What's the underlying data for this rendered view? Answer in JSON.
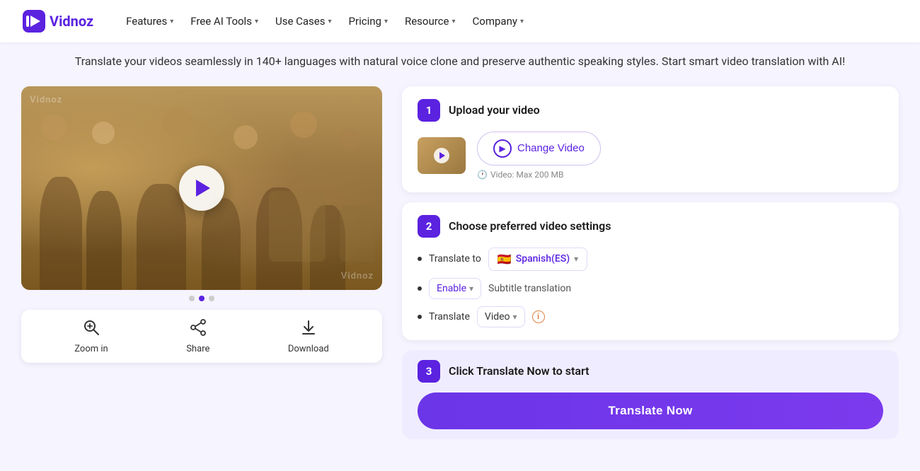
{
  "brand": {
    "name": "Vidnoz",
    "logo_text": "Vidnoz"
  },
  "nav": {
    "items": [
      {
        "label": "Features",
        "has_dropdown": true
      },
      {
        "label": "Free AI Tools",
        "has_dropdown": true
      },
      {
        "label": "Use Cases",
        "has_dropdown": true
      },
      {
        "label": "Pricing",
        "has_dropdown": true
      },
      {
        "label": "Resource",
        "has_dropdown": true
      },
      {
        "label": "Company",
        "has_dropdown": true
      }
    ]
  },
  "hero": {
    "subtitle": "Translate your videos seamlessly in 140+ languages with natural voice clone and preserve authentic speaking styles. Start smart video translation with AI!"
  },
  "video_player": {
    "watermark": "Vidnoz",
    "watermark2": "Vidnoz"
  },
  "controls": [
    {
      "id": "zoom-in",
      "icon": "🔍",
      "label": "Zoom in"
    },
    {
      "id": "share",
      "icon": "⎋",
      "label": "Share"
    },
    {
      "id": "download",
      "icon": "⬇",
      "label": "Download"
    }
  ],
  "steps": [
    {
      "number": "1",
      "title": "Upload your video",
      "change_video_label": "Change Video",
      "file_limit": "Video: Max 200 MB"
    },
    {
      "number": "2",
      "title": "Choose preferred video settings",
      "translate_to_label": "Translate to",
      "language_flag": "🇪🇸",
      "language_name": "Spanish(ES)",
      "enable_label": "Enable",
      "subtitle_label": "Subtitle translation",
      "translate_label": "Translate",
      "translate_type": "Video"
    },
    {
      "number": "3",
      "title": "Click Translate Now to start",
      "button_label": "Translate Now"
    }
  ]
}
